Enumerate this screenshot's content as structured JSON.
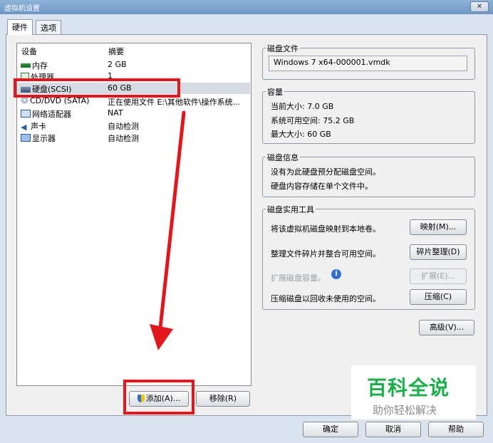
{
  "window": {
    "title": "虚拟机设置",
    "close": "✕"
  },
  "tabs": [
    "硬件",
    "选项"
  ],
  "device_list": {
    "headers": {
      "device": "设备",
      "summary": "摘要"
    },
    "rows": [
      {
        "name": "内存",
        "summary": "2 GB",
        "icon": "memory-icon"
      },
      {
        "name": "处理器",
        "summary": "1",
        "icon": "processor-icon"
      },
      {
        "name": "硬盘(SCSI)",
        "summary": "60 GB",
        "icon": "harddisk-icon"
      },
      {
        "name": "CD/DVD (SATA)",
        "summary": "正在使用文件 E:\\其他软件\\操作系统...",
        "icon": "cdrom-icon"
      },
      {
        "name": "网络适配器",
        "summary": "NAT",
        "icon": "network-icon"
      },
      {
        "name": "声卡",
        "summary": "自动检测",
        "icon": "sound-icon"
      },
      {
        "name": "显示器",
        "summary": "自动检测",
        "icon": "monitor-icon"
      }
    ]
  },
  "list_buttons": {
    "add": "添加(A)...",
    "remove": "移除(R)"
  },
  "disk_file": {
    "label": "磁盘文件",
    "value": "Windows 7 x64-000001.vmdk"
  },
  "capacity": {
    "label": "容量",
    "current": "当前大小: 7.0 GB",
    "available": "系统可用空间: 75.2 GB",
    "max": "最大大小: 60 GB"
  },
  "disk_info": {
    "label": "磁盘信息",
    "line1": "没有为此硬盘预分配磁盘空间。",
    "line2": "硬盘内容存储在单个文件中。"
  },
  "utilities": {
    "label": "磁盘实用工具",
    "map_text": "将该虚拟机磁盘映射到本地卷。",
    "map_btn": "映射(M)...",
    "defrag_text": "整理文件碎片并整合可用空间。",
    "defrag_btn": "碎片整理(D)",
    "expand_text": "扩展磁盘容量。",
    "expand_btn": "扩展(E)...",
    "compact_text": "压缩磁盘以回收未使用的空间。",
    "compact_btn": "压缩(C)"
  },
  "advanced_btn": "高级(V)...",
  "footer": {
    "ok": "确定",
    "cancel": "取消",
    "help": "帮助"
  },
  "watermark": {
    "title": "百科全说",
    "subtitle": "助你轻松解决"
  },
  "colors": {
    "highlight": "#e3161b",
    "watermark_green": "#19b04a"
  }
}
